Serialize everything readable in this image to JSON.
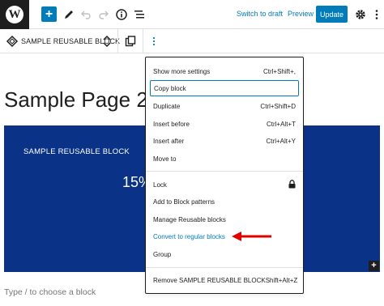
{
  "topbar": {
    "logo_letter": "W",
    "add_symbol": "+",
    "switch_to_draft": "Switch to draft",
    "preview": "Preview",
    "update": "Update",
    "icons": [
      "wordpress-logo",
      "add-block-icon",
      "pen-tool-icon",
      "undo-icon",
      "redo-icon",
      "info-icon",
      "list-view-icon",
      "settings-gear-icon",
      "more-options-icon"
    ]
  },
  "blockbar": {
    "block_name": "SAMPLE REUSABLE BLOCK",
    "icons": [
      "reusable-block-icon",
      "move-up-down-icon",
      "duplicate-icon",
      "more-vertical-icon"
    ]
  },
  "page": {
    "title": "Sample Page 2",
    "block_heading": "SAMPLE REUSABLE BLOCK",
    "block_stat": "15%",
    "corner_plus": "+",
    "placeholder": "Type / to choose a block"
  },
  "menu": {
    "group1": [
      {
        "label": "Show more settings",
        "shortcut": "Ctrl+Shift+,"
      },
      {
        "label": "Copy block",
        "shortcut": ""
      },
      {
        "label": "Duplicate",
        "shortcut": "Ctrl+Shift+D"
      },
      {
        "label": "Insert before",
        "shortcut": "Ctrl+Alt+T"
      },
      {
        "label": "Insert after",
        "shortcut": "Ctrl+Alt+Y"
      },
      {
        "label": "Move to",
        "shortcut": ""
      }
    ],
    "group2": [
      {
        "label": "Lock",
        "shortcut": ""
      },
      {
        "label": "Add to Block patterns",
        "shortcut": ""
      },
      {
        "label": "Manage Reusable blocks",
        "shortcut": ""
      },
      {
        "label": "Convert to regular blocks",
        "shortcut": ""
      },
      {
        "label": "Group",
        "shortcut": ""
      }
    ],
    "group3": [
      {
        "label": "Remove SAMPLE REUSABLE BLOCK",
        "shortcut": "Shift+Alt+Z"
      }
    ]
  },
  "colors": {
    "accent": "#007cba",
    "block_background": "#0a3388",
    "annotation_arrow": "#e00000"
  }
}
